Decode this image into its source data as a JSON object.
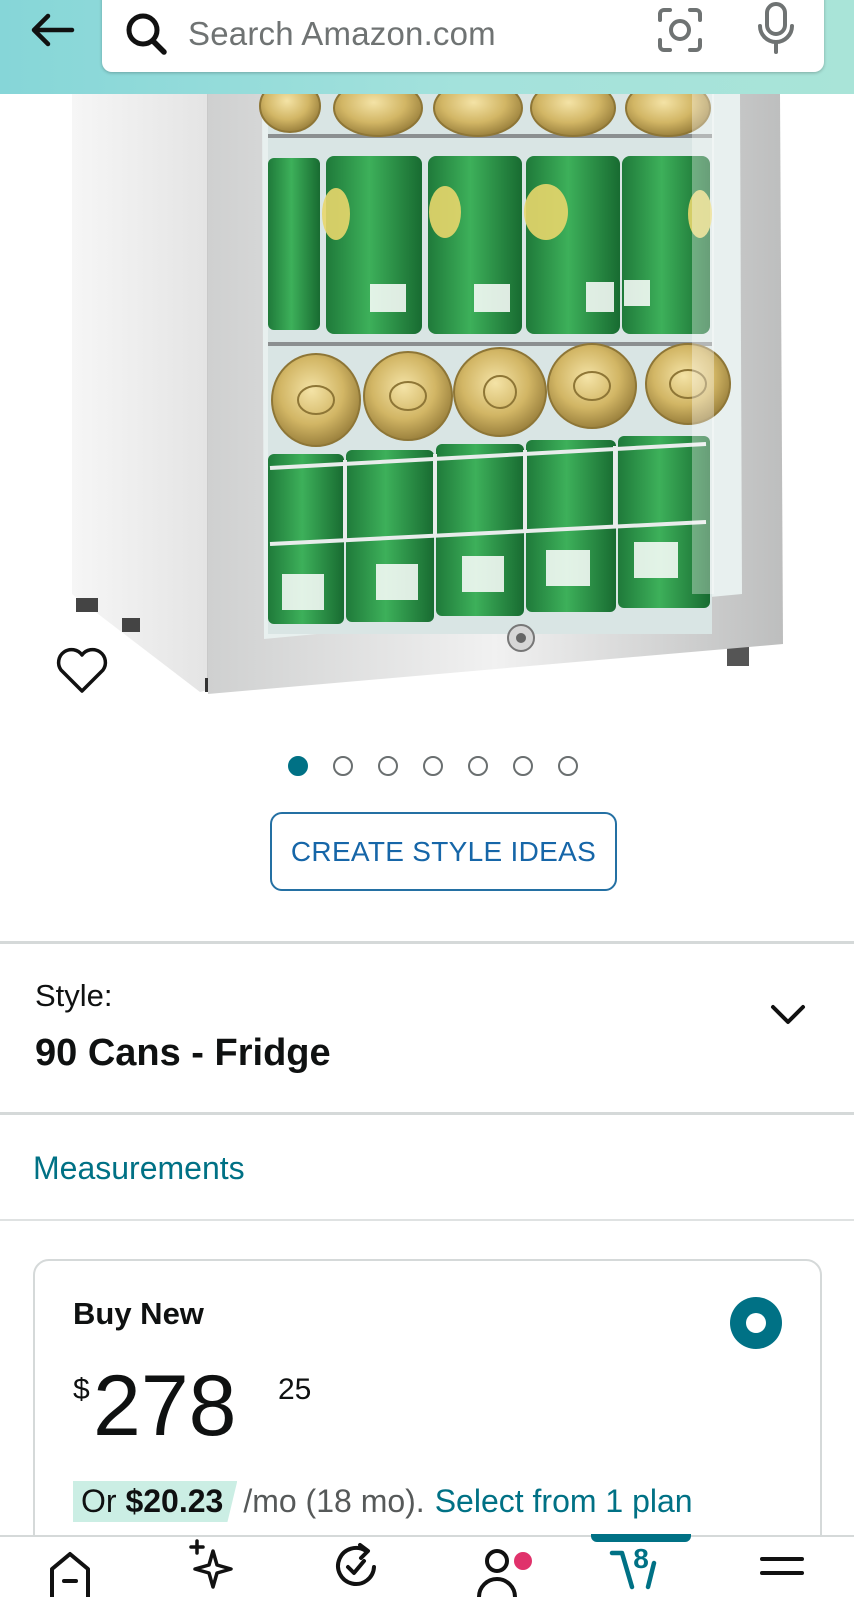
{
  "header": {
    "search_placeholder": "Search Amazon.com",
    "icons": [
      "back-arrow-icon",
      "search-icon",
      "camera-lens-icon",
      "microphone-icon"
    ]
  },
  "product": {
    "image_dots_count": 7,
    "active_dot_index": 0,
    "create_style_ideas_label": "CREATE STYLE IDEAS"
  },
  "style": {
    "label": "Style:",
    "value": "90 Cans - Fridge"
  },
  "measurements_label": "Measurements",
  "buy_box": {
    "title": "Buy New",
    "price_symbol": "$",
    "price_whole": "278",
    "price_fraction": "25",
    "installment_prefix": "Or ",
    "installment_amount": "$20.23",
    "installment_terms": "/mo (18 mo).",
    "installment_link": "Select from 1 plan",
    "selected": true
  },
  "bottom_nav": {
    "items": [
      "home-icon",
      "ai-sparkle-icon",
      "deals-icon",
      "account-icon",
      "cart-icon",
      "menu-icon"
    ],
    "cart_count": "8",
    "active_item": "cart"
  },
  "colors": {
    "header_start": "#86d6d8",
    "header_end": "#a9e4d8",
    "link": "#007185",
    "button_border": "#2470a3",
    "installment_highlight": "#cbeee4",
    "notification": "#e0326b"
  }
}
